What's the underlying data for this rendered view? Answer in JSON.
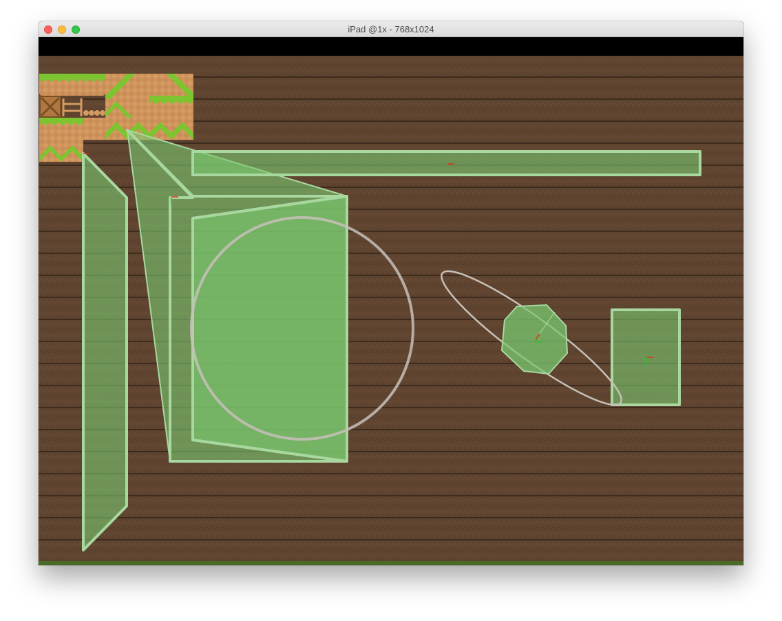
{
  "window": {
    "title": "iPad @1x - 768x1024"
  },
  "colors": {
    "ground_brown": "#5f4430",
    "row_line": "#1e140c",
    "physics_fill": "#79c870",
    "physics_stroke": "#a8d8a0",
    "ellipse_stroke": "#c8c0b8",
    "grass": "#7cc430",
    "dirt": "#d49a62",
    "axis_red": "#e03020",
    "axis_green": "#30c030"
  },
  "icons": {
    "close": "close-icon",
    "minimize": "minimize-icon",
    "zoom": "zoom-icon"
  }
}
